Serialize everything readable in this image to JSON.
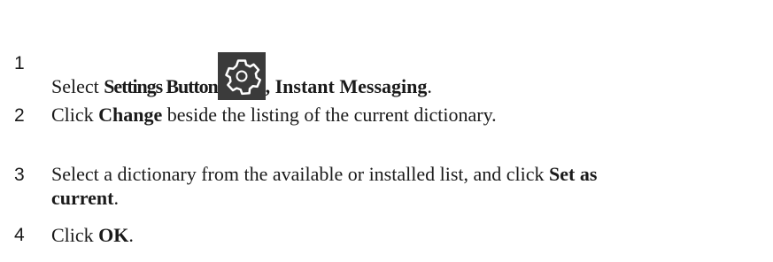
{
  "steps": [
    {
      "number": "1",
      "prefix": "Select ",
      "bold1": "Settings Button",
      "icon": "gear-icon",
      "bold2": ", Instant Messaging",
      "suffix": "."
    },
    {
      "number": "2",
      "prefix": "Click ",
      "bold1": "Change",
      "suffix": " beside the listing of the current dictionary."
    },
    {
      "number": "3",
      "line1_prefix": "Select a dictionary from the available or installed list, and click ",
      "line1_bold": "Set as",
      "line2_bold": "current",
      "line2_suffix": "."
    },
    {
      "number": "4",
      "prefix": "Click ",
      "bold1": "OK",
      "suffix": "."
    }
  ],
  "icon_colors": {
    "background": "#3b3b3b",
    "gear_stroke": "#ffffff"
  }
}
